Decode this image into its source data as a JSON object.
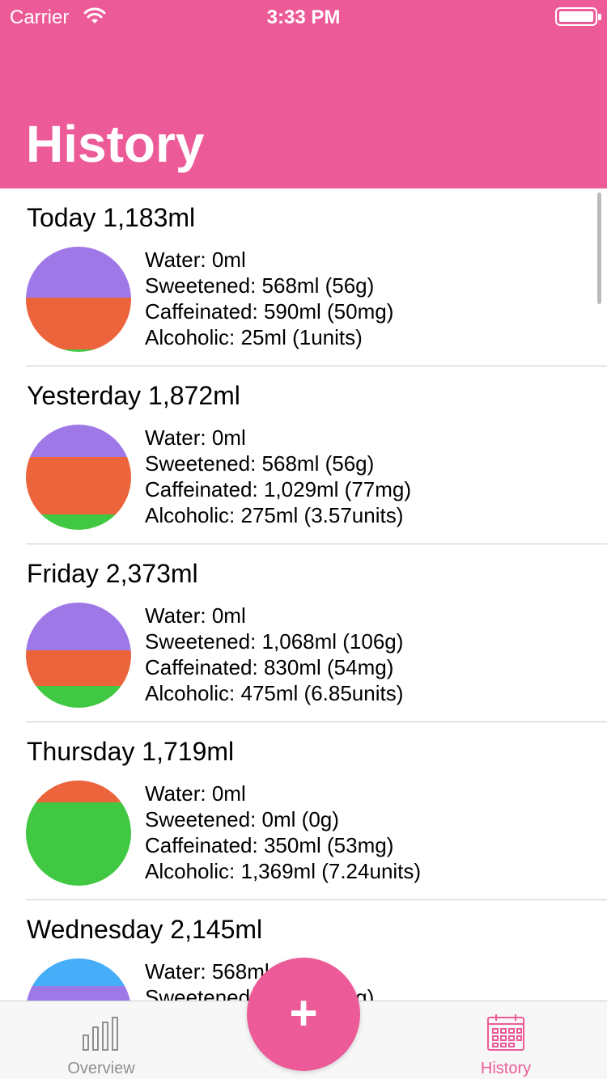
{
  "status_bar": {
    "carrier": "Carrier",
    "time": "3:33 PM",
    "wifi_icon": "wifi-icon",
    "battery_icon": "battery-icon"
  },
  "header": {
    "title": "History",
    "color": "#EC5B98"
  },
  "legend_colors": {
    "water": "#46AEF8",
    "sweetened": "#9F78E8",
    "caffeinated": "#EC643B",
    "alcoholic": "#41C842"
  },
  "days": [
    {
      "title": "Today 1,183ml",
      "water": "Water: 0ml",
      "sweetened": "Sweetened: 568ml (56g)",
      "caffeinated": "Caffeinated: 590ml (50mg)",
      "alcoholic": "Alcoholic: 25ml (1units)"
    },
    {
      "title": "Yesterday 1,872ml",
      "water": "Water: 0ml",
      "sweetened": "Sweetened: 568ml (56g)",
      "caffeinated": "Caffeinated: 1,029ml (77mg)",
      "alcoholic": "Alcoholic: 275ml (3.57units)"
    },
    {
      "title": "Friday 2,373ml",
      "water": "Water: 0ml",
      "sweetened": "Sweetened: 1,068ml (106g)",
      "caffeinated": "Caffeinated: 830ml (54mg)",
      "alcoholic": "Alcoholic: 475ml (6.85units)"
    },
    {
      "title": "Thursday 1,719ml",
      "water": "Water: 0ml",
      "sweetened": "Sweetened: 0ml (0g)",
      "caffeinated": "Caffeinated: 350ml (53mg)",
      "alcoholic": "Alcoholic: 1,369ml (7.24units)"
    },
    {
      "title": "Wednesday 2,145ml",
      "water": "Water: 568ml",
      "sweetened": "Sweetened: 568ml (56g)",
      "caffeinated": "",
      "alcoholic": ""
    }
  ],
  "tabbar": {
    "overview_label": "Overview",
    "history_label": "History",
    "overview_icon": "bar-chart-icon",
    "history_icon": "calendar-icon"
  },
  "fab": {
    "label": "+",
    "icon": "plus-icon"
  }
}
